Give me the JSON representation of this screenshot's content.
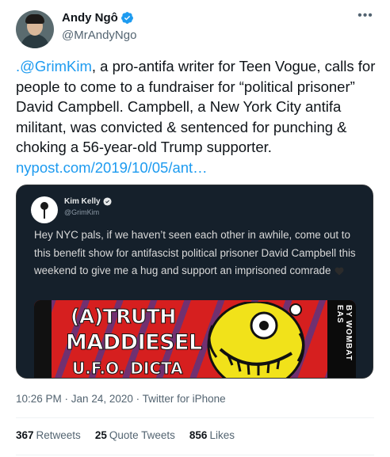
{
  "author": {
    "display_name": "Andy Ngô",
    "handle": "@MrAndyNgo",
    "verified": true,
    "avatar_icon": "profile-photo"
  },
  "more_icon": "more-horizontal-icon",
  "tweet": {
    "mention": ".@GrimKim",
    "body": ", a pro-antifa writer for Teen Vogue, calls for people to come to a fundraiser for “political prisoner” David Campbell. Campbell, a New York City antifa militant, was convicted & sentenced for punching & choking a 56-year-old Trump supporter. ",
    "link": "nypost.com/2019/10/05/ant…"
  },
  "embedded": {
    "name": "Kim Kelly",
    "handle": "@GrimKim",
    "verified": true,
    "text": "Hey NYC pals, if we haven’t seen each other in awhile, come out to this benefit show for antifascist political prisoner David Campbell this weekend to give me a hug and support an imprisoned comrade",
    "emoji": "black-heart",
    "poster": {
      "line1": "(A)TRUTH",
      "line2": "MADDIESEL",
      "line3": "U.F.O. DICTA",
      "side": "BY WOMBAT EAS"
    }
  },
  "meta": {
    "time": "10:26 PM",
    "separator": " · ",
    "date": "Jan 24, 2020",
    "source": "Twitter for iPhone"
  },
  "stats": [
    {
      "count": "367",
      "label": "Retweets"
    },
    {
      "count": "25",
      "label": "Quote Tweets"
    },
    {
      "count": "856",
      "label": "Likes"
    }
  ],
  "colors": {
    "link": "#1d9bf0",
    "verified": "#1d9bf0",
    "embed_bg": "#15202b"
  }
}
